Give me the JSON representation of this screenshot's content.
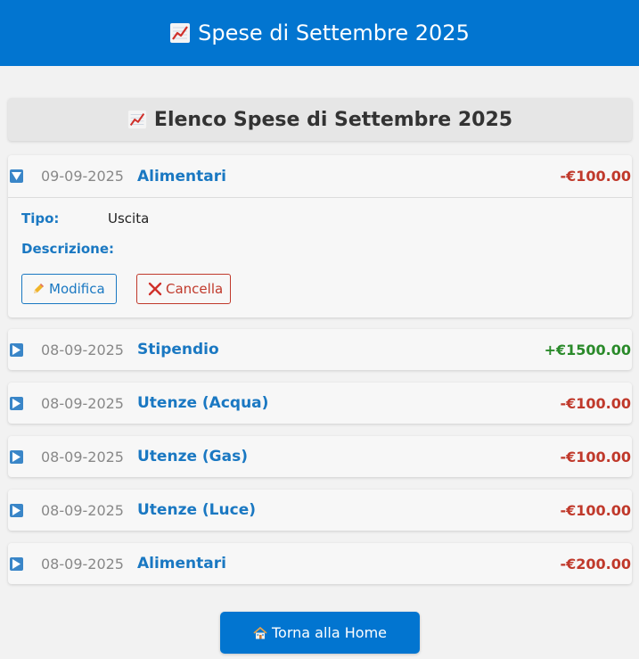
{
  "header": {
    "title": "Spese di Settembre 2025",
    "icon": "chart-increasing-icon"
  },
  "section": {
    "title": "Elenco Spese di Settembre 2025",
    "icon": "chart-increasing-icon"
  },
  "expenses": [
    {
      "date": "09-09-2025",
      "category": "Alimentari",
      "amount": "-€100.00",
      "sign": "negative",
      "expanded": true,
      "details": {
        "type_label": "Tipo:",
        "type_value": "Uscita",
        "description_label": "Descrizione:",
        "description_value": ""
      },
      "edit_label": "Modifica",
      "delete_label": "Cancella"
    },
    {
      "date": "08-09-2025",
      "category": "Stipendio",
      "amount": "+€1500.00",
      "sign": "positive"
    },
    {
      "date": "08-09-2025",
      "category": "Utenze (Acqua)",
      "amount": "-€100.00",
      "sign": "negative"
    },
    {
      "date": "08-09-2025",
      "category": "Utenze (Gas)",
      "amount": "-€100.00",
      "sign": "negative"
    },
    {
      "date": "08-09-2025",
      "category": "Utenze (Luce)",
      "amount": "-€100.00",
      "sign": "negative"
    },
    {
      "date": "08-09-2025",
      "category": "Alimentari",
      "amount": "-€200.00",
      "sign": "negative"
    }
  ],
  "footer": {
    "home_label": "Torna alla Home",
    "icon": "house-icon"
  },
  "colors": {
    "primary": "#0275d0",
    "negative": "#c0392b",
    "positive": "#2a8a2a",
    "label": "#1a78c2"
  }
}
